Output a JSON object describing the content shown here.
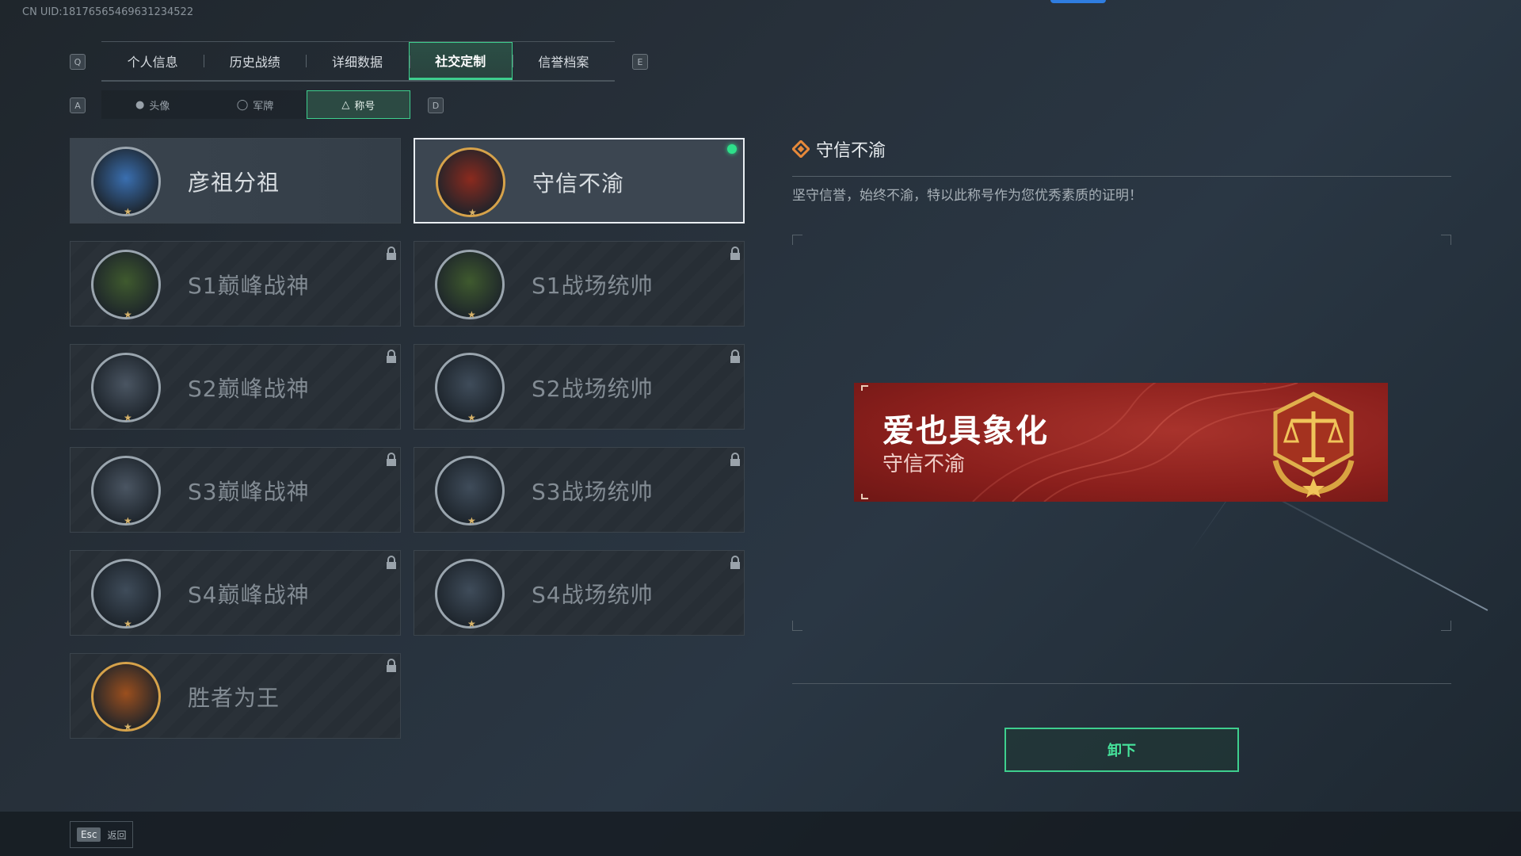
{
  "uid": "CN UID:18176565469631234522",
  "tab_keys": {
    "left": "Q",
    "right": "E"
  },
  "tabs": [
    "个人信息",
    "历史战绩",
    "详细数据",
    "社交定制",
    "信誉档案"
  ],
  "active_tab": 3,
  "subtab_keys": {
    "left": "A",
    "right": "D"
  },
  "subtabs": [
    "头像",
    "军牌",
    "称号"
  ],
  "active_subtab": 2,
  "titles": [
    {
      "name": "彦祖分祖",
      "state": "unlocked",
      "icon": "portrait-icon"
    },
    {
      "name": "守信不渝",
      "state": "selected",
      "icon": "scales-emblem-icon"
    },
    {
      "name": "S1巅峰战神",
      "state": "locked",
      "icon": "crocodile-emblem-icon"
    },
    {
      "name": "S1战场统帅",
      "state": "locked",
      "icon": "tank-emblem-icon"
    },
    {
      "name": "S2巅峰战神",
      "state": "locked",
      "icon": "triangle-emblem-icon"
    },
    {
      "name": "S2战场统帅",
      "state": "locked",
      "icon": "helicopter-emblem-icon"
    },
    {
      "name": "S3巅峰战神",
      "state": "locked",
      "icon": "globe-emblem-icon"
    },
    {
      "name": "S3战场统帅",
      "state": "locked",
      "icon": "armored-vehicle-emblem-icon"
    },
    {
      "name": "S4巅峰战神",
      "state": "locked",
      "icon": "helmet-emblem-icon"
    },
    {
      "name": "S4战场统帅",
      "state": "locked",
      "icon": "missile-emblem-icon"
    },
    {
      "name": "胜者为王",
      "state": "locked",
      "icon": "medal-emblem-icon"
    }
  ],
  "detail": {
    "title": "守信不渝",
    "description": "坚守信誉，始终不渝，特以此称号作为您优秀素质的证明！",
    "preview_player": "爱也具象化",
    "preview_title": "守信不渝"
  },
  "unequip_label": "卸下",
  "footer": {
    "key": "Esc",
    "label": "返回"
  },
  "colors": {
    "accent": "#3ecf8e",
    "preview_red": "#8a1f1c",
    "gold": "#d8a24a"
  }
}
